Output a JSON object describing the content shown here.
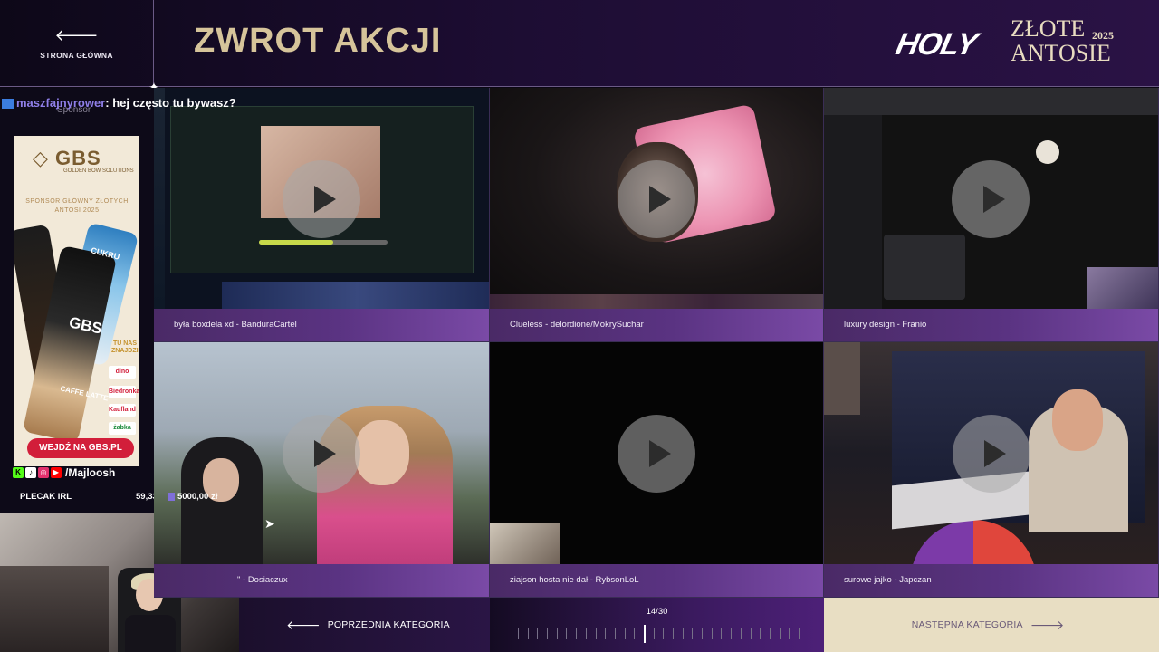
{
  "header": {
    "home_label": "STRONA GŁÓWNA",
    "title": "ZWROT AKCJI",
    "logo": {
      "brand": "HOLY",
      "event_line1": "ZŁOTE",
      "event_line2": "ANTOSIE",
      "year": "2025"
    }
  },
  "chat": {
    "user": "maszfajnyrower",
    "message": ": hej często tu bywasz?"
  },
  "sponsor": {
    "label": "Sponsor",
    "brand": "GBS",
    "brand_sub": "GOLDEN BOW SOLUTIONS",
    "headline": "SPONSOR GŁÓWNY ZŁOTYCH ANTOSI 2025",
    "can_label_1": "GBS",
    "can_label_2": "CUKRU",
    "can_label_3": "CAFFE LATTE",
    "tu_nas": "TU NAS ZNAJDZIESZ",
    "stores": [
      "dino",
      "Biedronka",
      "Kaufland",
      "żabka"
    ],
    "cta": "WEJDŹ NA GBS.PL"
  },
  "stream_overlay": {
    "handle": "/Majloosh",
    "goal_label": "PLECAK IRL",
    "goal_current": "59,33 zł",
    "goal_target": "5000,00 zł"
  },
  "videos": [
    {
      "caption": "była boxdela xd - BanduraCartel"
    },
    {
      "caption": "Clueless - delordione/MokrySuchar"
    },
    {
      "caption": "luxury design - Franio"
    },
    {
      "caption": "\" - Dosiaczux"
    },
    {
      "caption": "ziajson hosta nie dał - RybsonLoL"
    },
    {
      "caption": "surowe jajko - Japczan"
    }
  ],
  "video_overlay": {
    "progress_fraction": 0.58
  },
  "nav": {
    "prev_label": "POPRZEDNIA KATEGORIA",
    "next_label": "NASTĘPNA KATEGORIA",
    "counter": "14/30",
    "current": 14,
    "total": 30
  },
  "colors": {
    "accent_gold": "#d6c49a",
    "caption_purple": "#5a3382",
    "next_bg": "#e8dec3"
  }
}
